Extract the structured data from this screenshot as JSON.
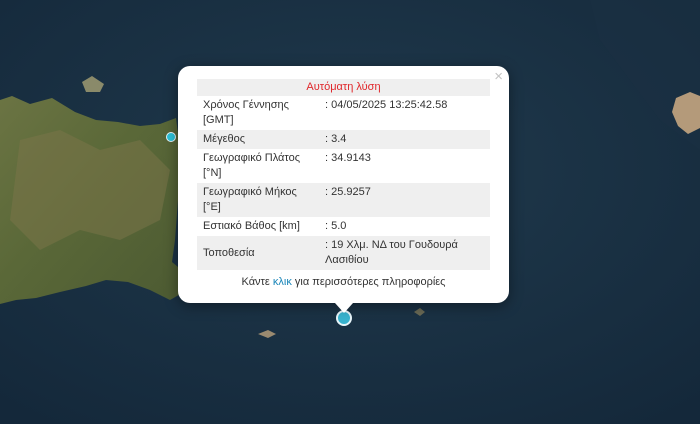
{
  "popup": {
    "title": "Αυτόματη λύση",
    "rows": [
      {
        "label": "Χρόνος Γέννησης [GMT]",
        "value": ": 04/05/2025 13:25:42.58"
      },
      {
        "label": "Μέγεθος",
        "value": ": 3.4"
      },
      {
        "label": "Γεωγραφικό Πλάτος [°N]",
        "value": ": 34.9143"
      },
      {
        "label": "Γεωγραφικό Μήκος [°E]",
        "value": ": 25.9257"
      },
      {
        "label": "Εστιακό Βάθος [km]",
        "value": ": 5.0"
      },
      {
        "label": "Τοποθεσία",
        "value": ": 19 Χλμ. ΝΔ του Γουδουρά Λασιθίου"
      }
    ],
    "more_prefix": "Κάντε ",
    "more_link": "κλικ",
    "more_suffix": " για περισσότερες πληροφορίες",
    "close": "×"
  },
  "colors": {
    "sea": "#1b3344",
    "land": "#5e6b3c",
    "marker": "#38b3cf",
    "title_text": "#e0262a",
    "link": "#1a86b9"
  }
}
